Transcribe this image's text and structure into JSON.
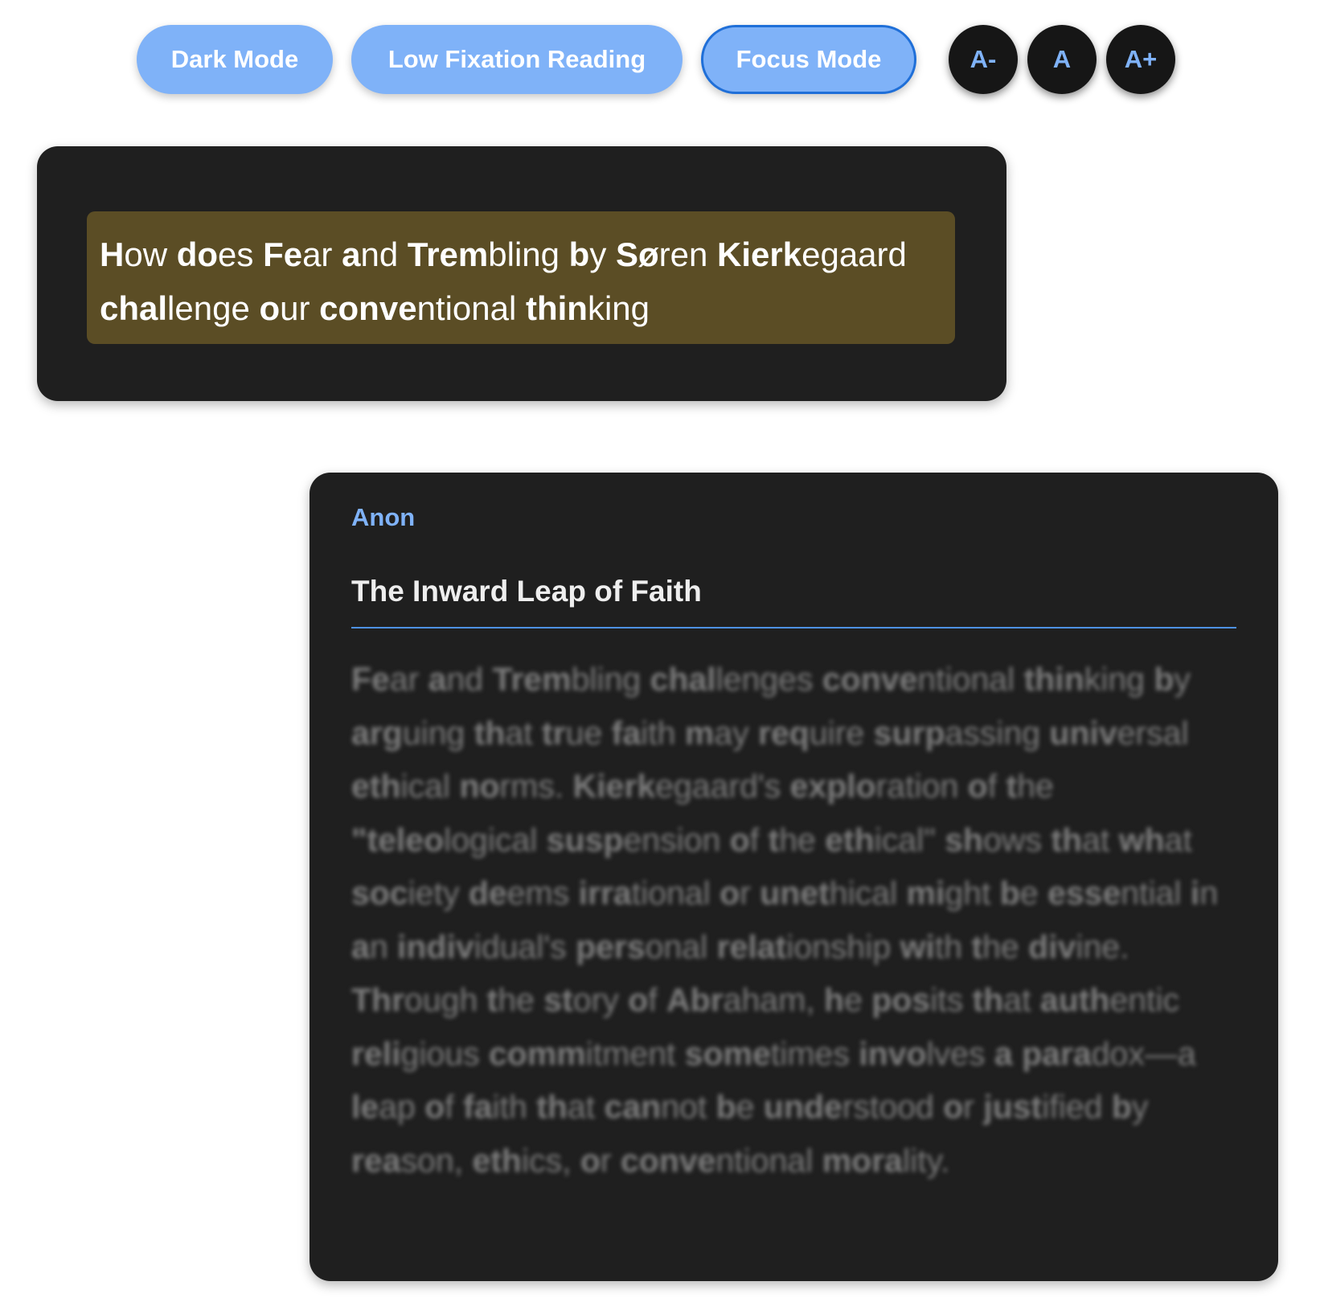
{
  "toolbar": {
    "dark_mode_label": "Dark Mode",
    "low_fixation_label": "Low Fixation Reading",
    "focus_mode_label": "Focus Mode",
    "font_decrease_label": "A-",
    "font_reset_label": "A",
    "font_increase_label": "A+"
  },
  "question": {
    "text": "How does Fear and Trembling by Søren Kierkegaard challenge our conventional thinking"
  },
  "answer": {
    "author": "Anon",
    "title": "The Inward Leap of Faith",
    "body": "Fear and Trembling challenges conventional thinking by arguing that true faith may require surpassing universal ethical norms. Kierkegaard's exploration of the \"teleological suspension of the ethical\" shows that what society deems irrational or unethical might be essential in an individual's personal relationship with the divine. Through the story of Abraham, he posits that authentic religious commitment sometimes involves a paradox—a leap of faith that cannot be understood or justified by reason, ethics, or conventional morality."
  },
  "colors": {
    "pill_bg": "#7fb2f8",
    "focus_border": "#1f6fd8",
    "card_bg": "#1f1f1f",
    "question_highlight": "#5b4d25",
    "accent_blue": "#7fb2f8",
    "title_underline": "#4e91e3"
  }
}
